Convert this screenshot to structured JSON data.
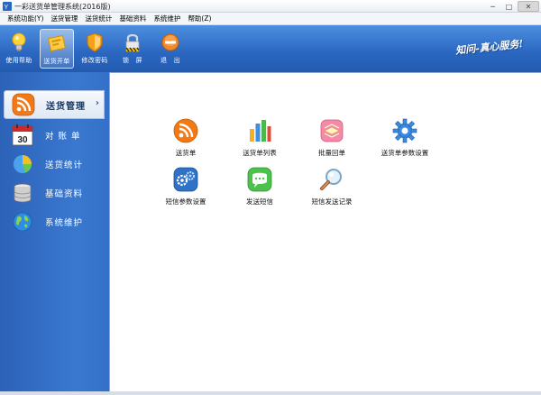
{
  "window": {
    "title": "一彩送货单管理系统(2016版)",
    "minimize": "─",
    "maximize": "□",
    "close": "✕"
  },
  "menubar": {
    "items": [
      "系统功能(Y)",
      "送货管理",
      "送货统计",
      "基础资料",
      "系统维护",
      "帮助(Z)"
    ]
  },
  "toolbar": {
    "items": [
      {
        "label": "使用帮助",
        "icon": "lightbulb-icon"
      },
      {
        "label": "送货开单",
        "icon": "ticket-icon",
        "active": true
      },
      {
        "label": "修改密码",
        "icon": "shield-icon"
      },
      {
        "label": "锁　屏",
        "icon": "lock-icon"
      },
      {
        "label": "退　出",
        "icon": "exit-icon"
      }
    ],
    "slogan": "知问-真心服务!"
  },
  "sidebar": {
    "items": [
      {
        "label": "送货管理",
        "icon": "rss-icon",
        "active": true
      },
      {
        "label": "对 账 单",
        "icon": "calendar-icon"
      },
      {
        "label": "送货统计",
        "icon": "pie-chart-icon"
      },
      {
        "label": "基础资料",
        "icon": "database-icon"
      },
      {
        "label": "系统维护",
        "icon": "globe-icon"
      }
    ],
    "active_arrow": "›",
    "calendar_day": "30"
  },
  "main": {
    "icons": [
      {
        "label": "送货单",
        "icon": "rss-icon"
      },
      {
        "label": "送货单列表",
        "icon": "bar-chart-icon"
      },
      {
        "label": "批量回单",
        "icon": "stack-icon"
      },
      {
        "label": "送货单参数设置",
        "icon": "gear-icon"
      },
      {
        "label": "短信参数设置",
        "icon": "gears-icon"
      },
      {
        "label": "发送短信",
        "icon": "chat-icon"
      },
      {
        "label": "短信发送记录",
        "icon": "magnifier-icon"
      }
    ]
  },
  "colors": {
    "accent_blue": "#2a66c0",
    "sidebar_blue": "#3470c8",
    "rss_orange": "#f07a1a",
    "chat_green": "#4cc24c"
  }
}
